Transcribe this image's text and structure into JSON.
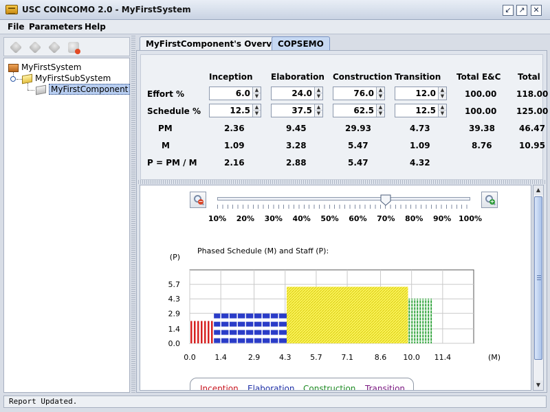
{
  "window": {
    "title": "USC COINCOMO 2.0 - MyFirstSystem"
  },
  "menu": [
    {
      "label": "File"
    },
    {
      "label": "Parameters"
    },
    {
      "label": "Help"
    }
  ],
  "tree": {
    "system": "MyFirstSystem",
    "subsystem": "MyFirstSubSystem",
    "component": "MyFirstComponent"
  },
  "tabs": [
    {
      "label": "MyFirstComponent's Overview"
    },
    {
      "label": "COPSEMO"
    }
  ],
  "table": {
    "headers": [
      "Inception",
      "Elaboration",
      "Construction",
      "Transition",
      "Total E&C",
      "Total"
    ],
    "effort": {
      "label": "Effort %",
      "values": [
        "6.0",
        "24.0",
        "76.0",
        "12.0"
      ],
      "total_ec": "100.00",
      "total": "118.00"
    },
    "schedule": {
      "label": "Schedule %",
      "values": [
        "12.5",
        "37.5",
        "62.5",
        "12.5"
      ],
      "total_ec": "100.00",
      "total": "125.00"
    },
    "pm": {
      "label": "PM",
      "values": [
        "2.36",
        "9.45",
        "29.93",
        "4.73"
      ],
      "total_ec": "39.38",
      "total": "46.47"
    },
    "m": {
      "label": "M",
      "values": [
        "1.09",
        "3.28",
        "5.47",
        "1.09"
      ],
      "total_ec": "8.76",
      "total": "10.95"
    },
    "p": {
      "label": "P = PM / M",
      "values": [
        "2.16",
        "2.88",
        "5.47",
        "4.32"
      ]
    }
  },
  "slider": {
    "labels": [
      "10%",
      "20%",
      "30%",
      "40%",
      "50%",
      "60%",
      "70%",
      "80%",
      "90%",
      "100%"
    ],
    "value_percent": 70
  },
  "chart_data": {
    "type": "bar",
    "title": "Phased Schedule (M) and Staff (P):",
    "ylabel": "(P)",
    "xlabel": "(M)",
    "yticks": [
      "5.7",
      "4.3",
      "2.9",
      "1.4",
      "0.0"
    ],
    "xticks": [
      "0.0",
      "1.4",
      "2.9",
      "4.3",
      "5.7",
      "7.1",
      "8.6",
      "10.0",
      "11.4"
    ],
    "xlim": [
      0,
      12.8
    ],
    "ylim": [
      0,
      7.1
    ],
    "phases": [
      {
        "name": "Inception",
        "start": 0.0,
        "duration": 1.09,
        "staff": 2.16,
        "color": "#d62020"
      },
      {
        "name": "Elaboration",
        "start": 1.09,
        "duration": 3.28,
        "staff": 2.88,
        "color": "#2a3cc8"
      },
      {
        "name": "Construction",
        "start": 4.37,
        "duration": 5.47,
        "staff": 5.47,
        "color": "#e8e21a"
      },
      {
        "name": "Transition",
        "start": 9.84,
        "duration": 1.09,
        "staff": 4.32,
        "color": "#1b9a2a"
      }
    ]
  },
  "legend": [
    {
      "label": "Inception",
      "color": "#c8141e"
    },
    {
      "label": "Elaboration",
      "color": "#1c2ea6"
    },
    {
      "label": "Construction",
      "color": "#1d8a22"
    },
    {
      "label": "Transition",
      "color": "#7a1680"
    }
  ],
  "status": {
    "text": "Report Updated."
  }
}
